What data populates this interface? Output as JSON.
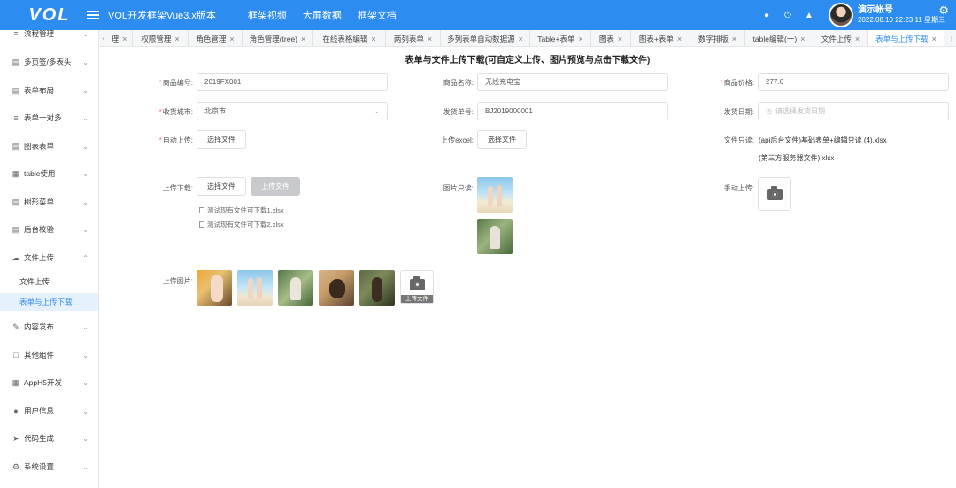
{
  "header": {
    "logo": "VOL",
    "app_title": "VOL开发框架Vue3.x版本",
    "links": [
      "框架视频",
      "大屏数据",
      "框架文档"
    ],
    "user_name": "演示帐号",
    "user_time": "2022.08.10 22:23:11 星期三",
    "icons": [
      "user-icon",
      "power-icon",
      "bell-icon",
      "gear-icon"
    ]
  },
  "sidebar": {
    "items": [
      {
        "label": "流程管理",
        "icon": "sliders-icon"
      },
      {
        "label": "多页签/多表头",
        "icon": "page-icon"
      },
      {
        "label": "表单布局",
        "icon": "form-icon"
      },
      {
        "label": "表单一对多",
        "icon": "sliders-icon"
      },
      {
        "label": "图表表单",
        "icon": "chart-icon"
      },
      {
        "label": "table使用",
        "icon": "calendar-icon"
      },
      {
        "label": "树形菜单",
        "icon": "doc-icon"
      },
      {
        "label": "后台校验",
        "icon": "page-icon"
      },
      {
        "label": "文件上传",
        "icon": "cloud-upload-icon"
      },
      {
        "label": "内容发布",
        "icon": "edit-icon"
      },
      {
        "label": "其他组件",
        "icon": "folder-icon"
      },
      {
        "label": "AppH5开发",
        "icon": "grid-icon"
      },
      {
        "label": "用户信息",
        "icon": "user-icon"
      },
      {
        "label": "代码生成",
        "icon": "send-icon"
      },
      {
        "label": "系统设置",
        "icon": "gear-icon"
      }
    ],
    "sub_items": [
      "文件上传",
      "表单与上传下载"
    ],
    "active_sub": "表单与上传下载"
  },
  "tabs": [
    {
      "label": "理"
    },
    {
      "label": "权限管理"
    },
    {
      "label": "角色管理"
    },
    {
      "label": "角色管理(tree)"
    },
    {
      "label": "在线表格编辑"
    },
    {
      "label": "两列表单"
    },
    {
      "label": "多列表单自动数据源"
    },
    {
      "label": "Table+表单"
    },
    {
      "label": "图表"
    },
    {
      "label": "图表+表单"
    },
    {
      "label": "数字排版"
    },
    {
      "label": "table编辑(一)"
    },
    {
      "label": "文件上传"
    },
    {
      "label": "表单与上传下载"
    }
  ],
  "form": {
    "title": "表单与文件上传下载(可自定义上传、图片预览与点击下载文件)",
    "product_code_label": "商品编号:",
    "product_code": "2019FX001",
    "product_name_label": "商品名称:",
    "product_name": "无线充电宝",
    "price_label": "商品价格:",
    "price": "277.6",
    "city_label": "收货城市:",
    "city": "北京市",
    "ship_no_label": "发货单号:",
    "ship_no": "BJ2019000001",
    "ship_date_label": "发货日期:",
    "ship_date_placeholder": "请选择发货日期",
    "auto_upload_label": "自动上传:",
    "choose_file": "选择文件",
    "excel_label": "上传excel:",
    "readonly_file_label": "文件只读:",
    "readonly_file_1": "(api后台文件)基础表单+编辑只读 (4).xlsx",
    "readonly_file_2": "(第三方服务器文件).xlsx",
    "upload_download_label": "上传下载:",
    "upload_file_btn": "上传文件",
    "files": [
      "测试现有文件可下载1.xlsx",
      "测试现有文件可下载2.xlsx"
    ],
    "image_readonly_label": "图片只读:",
    "manual_upload_label": "手动上传:",
    "upload_image_label": "上传图片:",
    "upload_caption": "上传文件"
  }
}
